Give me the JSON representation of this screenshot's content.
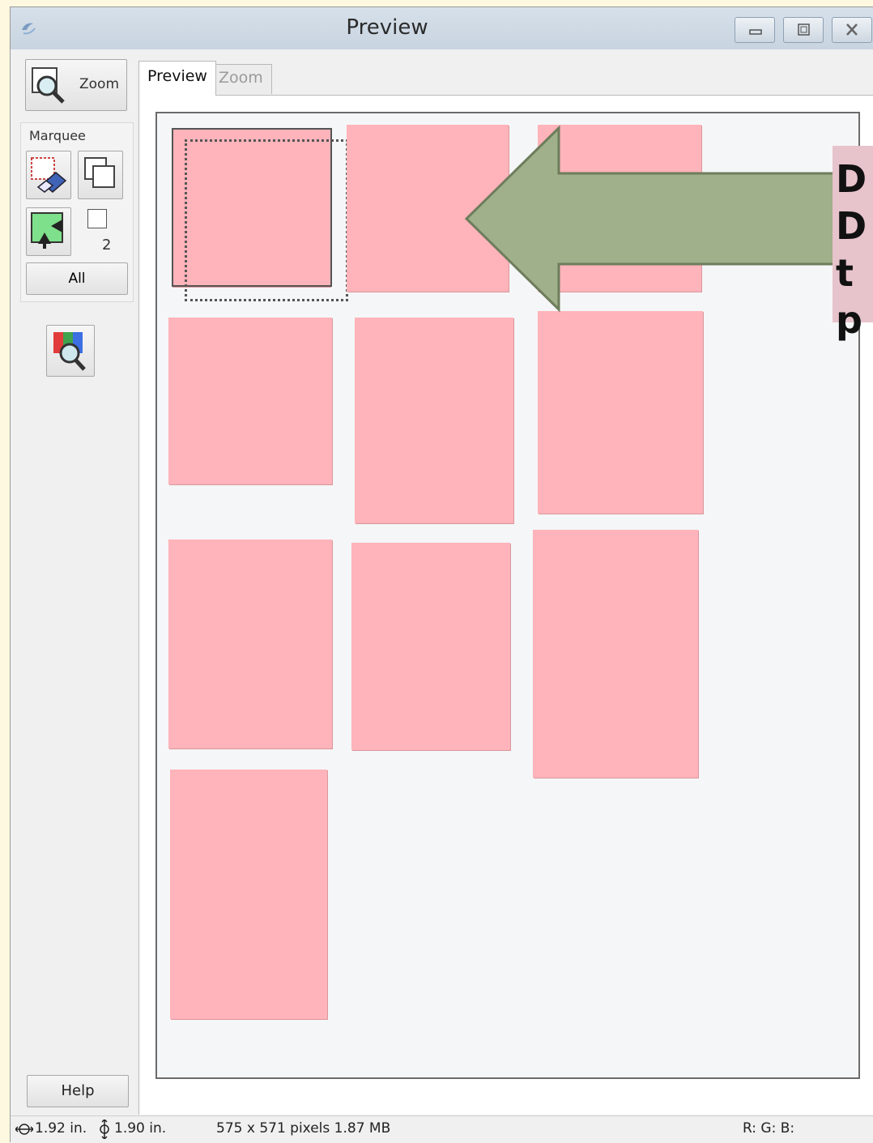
{
  "window": {
    "title": "Preview",
    "controls": [
      "minimize",
      "maximize",
      "close"
    ]
  },
  "toolbar": {
    "zoom_label": "Zoom",
    "marquee_label": "Marquee",
    "marquee_count": "2",
    "all_label": "All",
    "help_label": "Help"
  },
  "tabs": [
    {
      "label": "Preview",
      "active": true
    },
    {
      "label": "Zoom",
      "active": false
    }
  ],
  "status": {
    "width": "1.92 in.",
    "height": "1.90 in.",
    "size": "575 x 571 pixels 1.87 MB",
    "rgb": "R: G: B:"
  },
  "callout": {
    "lines": [
      "D",
      "D",
      "t",
      "p"
    ],
    "box_color": "#e7c3cc",
    "arrow_color": "#9fb08a"
  },
  "colors": {
    "photo": "#ffb3ba",
    "background": "#fdf8df"
  }
}
